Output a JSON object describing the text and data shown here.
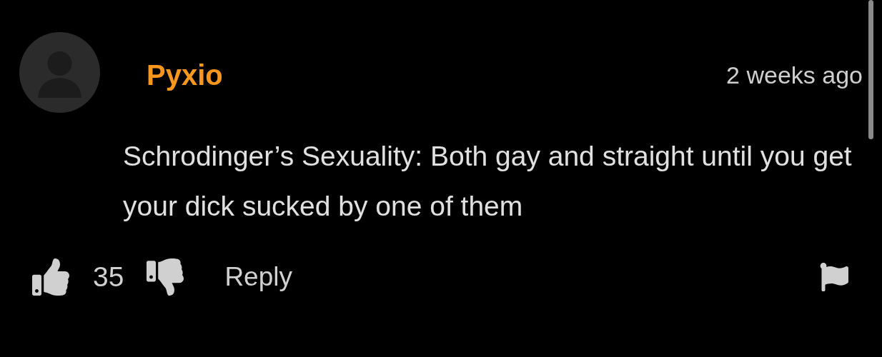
{
  "comment": {
    "author": "Pyxio",
    "time": "2 weeks ago",
    "text": "Schrodinger’s Sexuality: Both gay and straight until you get your dick sucked by one of them",
    "likes": "35",
    "reply": "Reply"
  }
}
